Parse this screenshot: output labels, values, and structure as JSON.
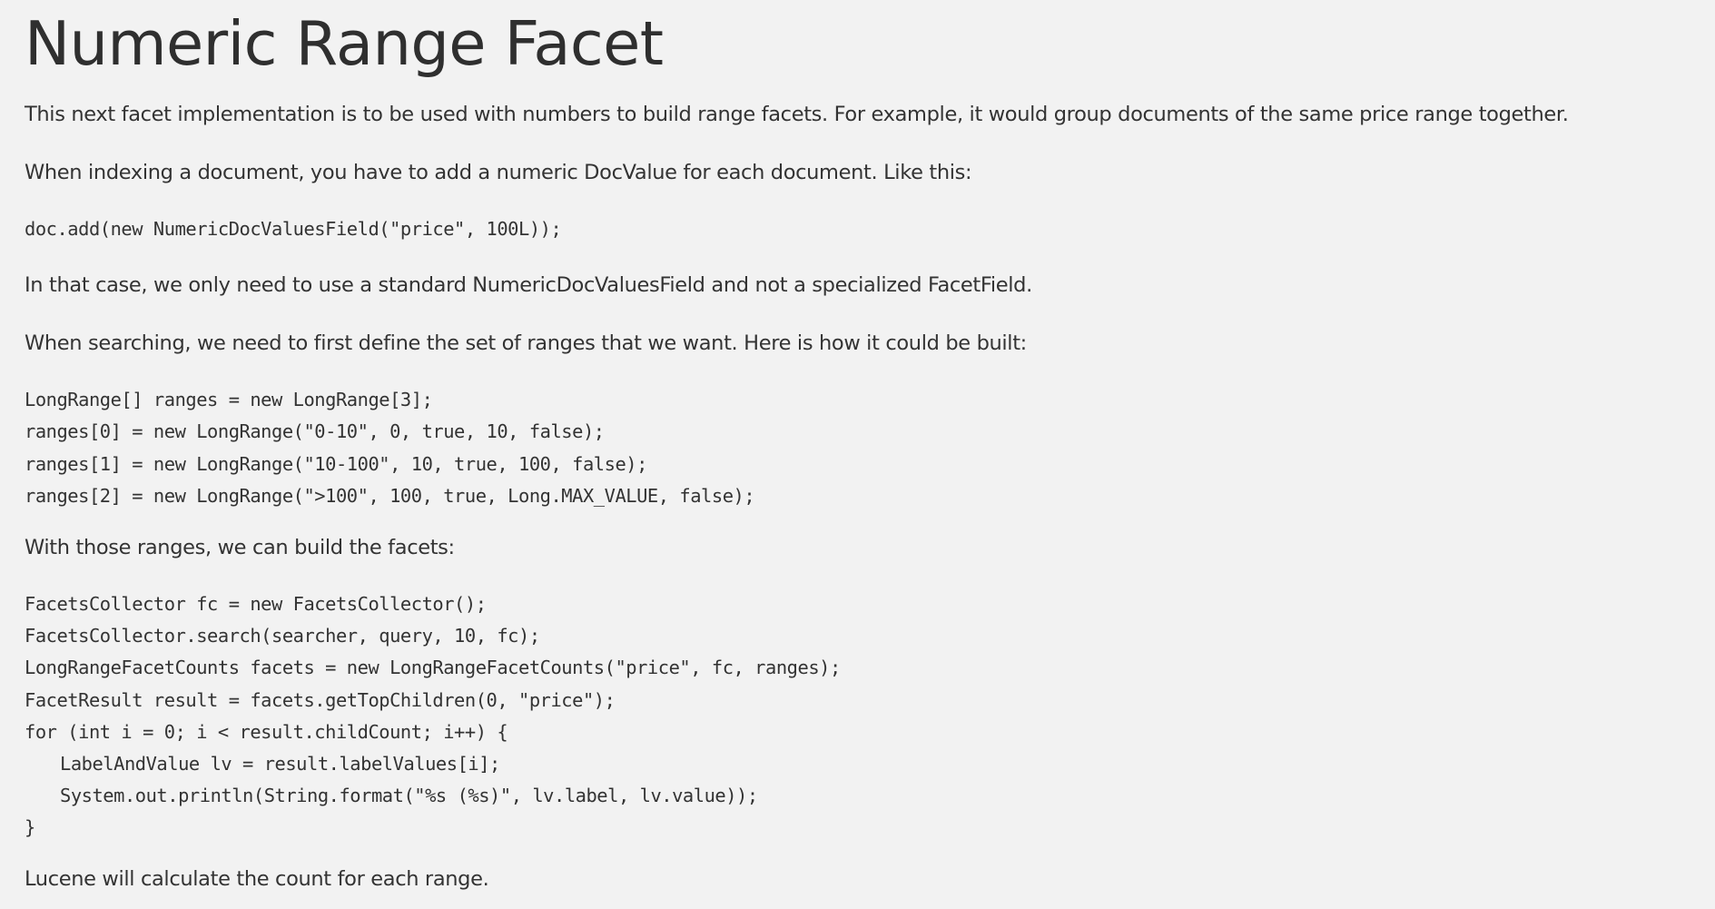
{
  "article": {
    "title": "Numeric Range Facet",
    "intro": "This next facet implementation is to be used with numbers to build range facets. For example, it would group documents of the same price range together.",
    "indexing_text": "When indexing a document, you have to add a numeric DocValue for each document. Like this:",
    "indexing_code": [
      "doc.add(new NumericDocValuesField(\"price\", 100L));"
    ],
    "field_note": "In that case, we only need to use a standard NumericDocValuesField and not a specialized FacetField.",
    "searching_text": "When searching, we need to first define the set of ranges that we want. Here is how it could be built:",
    "ranges_code": [
      "LongRange[] ranges = new LongRange[3];",
      "ranges[0] = new LongRange(\"0-10\", 0, true, 10, false);",
      "ranges[1] = new LongRange(\"10-100\", 10, true, 100, false);",
      "ranges[2] = new LongRange(\">100\", 100, true, Long.MAX_VALUE, false);"
    ],
    "build_text": "With those ranges, we can build the facets:",
    "facets_code": [
      "FacetsCollector fc = new FacetsCollector();",
      "FacetsCollector.search(searcher, query, 10, fc);",
      "LongRangeFacetCounts facets = new LongRangeFacetCounts(\"price\", fc, ranges);",
      "FacetResult result = facets.getTopChildren(0, \"price\");",
      "for (int i = 0; i < result.childCount; i++) {",
      "LabelAndValue lv = result.labelValues[i];",
      "System.out.println(String.format(\"%s (%s)\", lv.label, lv.value));",
      "}"
    ],
    "conclusion": "Lucene will calculate the count for each range."
  }
}
